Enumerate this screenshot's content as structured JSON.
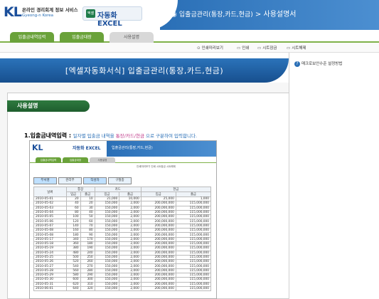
{
  "header": {
    "logo_mark": "KL",
    "logo_title": "온라인 경리회계 정보 서비스",
    "logo_sub": "Gyeong-n Korea",
    "product_icon": "엑셀",
    "product": "자동화 EXCEL",
    "breadcrumb_section": "입출금관리(통장,카드,현금)",
    "breadcrumb_sep": ">",
    "breadcrumb_page": "사용설명서"
  },
  "tabs": [
    {
      "label": "입출금내역입력"
    },
    {
      "label": "입출금대장"
    },
    {
      "label": "사용설명"
    }
  ],
  "toolbar": {
    "preview": "인쇄미리보기",
    "print": "인쇄",
    "sheet_lock": "시트잠금",
    "sheet_unlock": "시트해제"
  },
  "banner_title": "[엑셀자동화서식] 입출금관리(통장,카드,현금)",
  "right_button": "매크로보안수준 설정방법",
  "section_title": "사용설명",
  "step": {
    "number": "1.입출금내역입력 :",
    "desc_a": "일자별 입출금 내역을",
    "desc_hl": "통장/카드/현금",
    "desc_b": "으로 구분하여 입력합니다."
  },
  "shot": {
    "logo_mark": "KL",
    "product": "자동화 EXCEL",
    "breadcrumb": "입출금관리(통장,카드,현금)",
    "tabs": [
      "입출금내역입력",
      "입출금대장",
      "사용설명"
    ],
    "toolbar": "인쇄미리보기  인쇄  시트잠금  시트해제",
    "buttons": [
      "부서명",
      "관리부",
      "작성자",
      "구철중"
    ],
    "header_groups": [
      "통장",
      "카드",
      "현금"
    ],
    "columns": [
      "날짜",
      "입금",
      "출금",
      "입금",
      "출금",
      "입금",
      "출금"
    ],
    "rows": [
      [
        "2010-05-01",
        "20",
        "10",
        "21,000",
        "10,000",
        "25,000",
        "1,000"
      ],
      [
        "2010-05-02",
        "40",
        "20",
        "150,000",
        "2,000",
        "200,000,000",
        "115,000,000"
      ],
      [
        "2010-05-03",
        "60",
        "30",
        "150,000",
        "2,000",
        "200,000,000",
        "115,000,000"
      ],
      [
        "2010-05-04",
        "80",
        "40",
        "150,000",
        "2,000",
        "200,000,000",
        "115,000,000"
      ],
      [
        "2010-05-05",
        "100",
        "50",
        "150,000",
        "2,000",
        "200,000,000",
        "115,000,000"
      ],
      [
        "2010-05-06",
        "120",
        "60",
        "150,000",
        "2,000",
        "200,000,000",
        "115,000,000"
      ],
      [
        "2010-05-07",
        "140",
        "70",
        "150,000",
        "2,000",
        "200,000,000",
        "115,000,000"
      ],
      [
        "2010-05-08",
        "160",
        "80",
        "150,000",
        "2,000",
        "200,000,000",
        "115,000,000"
      ],
      [
        "2010-05-08",
        "180",
        "90",
        "150,000",
        "2,000",
        "200,000,000",
        "115,000,000"
      ],
      [
        "2010-05-17",
        "340",
        "170",
        "150,000",
        "2,000",
        "200,000,000",
        "115,000,000"
      ],
      [
        "2010-05-18",
        "360",
        "180",
        "150,000",
        "2,000",
        "200,000,000",
        "115,000,000"
      ],
      [
        "2010-05-19",
        "380",
        "190",
        "150,000",
        "2,000",
        "200,000,000",
        "115,000,000"
      ],
      [
        "2010-05-24",
        "480",
        "240",
        "150,000",
        "2,000",
        "200,000,000",
        "115,000,000"
      ],
      [
        "2010-05-25",
        "500",
        "250",
        "150,000",
        "2,000",
        "200,000,000",
        "115,000,000"
      ],
      [
        "2010-05-26",
        "520",
        "260",
        "150,000",
        "2,000",
        "200,000,000",
        "115,000,000"
      ],
      [
        "2010-05-27",
        "540",
        "270",
        "150,000",
        "2,000",
        "200,000,000",
        "115,000,000"
      ],
      [
        "2010-05-28",
        "560",
        "280",
        "150,000",
        "2,000",
        "200,000,000",
        "115,000,000"
      ],
      [
        "2010-05-29",
        "580",
        "290",
        "150,000",
        "2,000",
        "200,000,000",
        "115,000,000"
      ],
      [
        "2010-05-30",
        "600",
        "300",
        "150,000",
        "2,000",
        "200,000,000",
        "115,000,000"
      ],
      [
        "2010-05-31",
        "620",
        "310",
        "150,000",
        "2,000",
        "200,000,000",
        "115,000,000"
      ],
      [
        "2010-06-01",
        "640",
        "320",
        "150,000",
        "2,000",
        "200,000,000",
        "115,000,000"
      ]
    ]
  }
}
